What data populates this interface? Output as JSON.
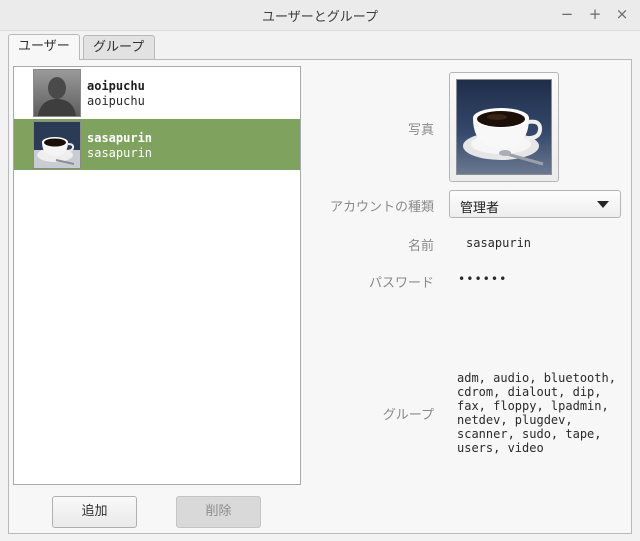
{
  "window": {
    "title": "ユーザーとグループ",
    "minimize_glyph": "−",
    "maximize_glyph": "+",
    "close_glyph": "×"
  },
  "tabs": [
    {
      "label": "ユーザー",
      "active": true
    },
    {
      "label": "グループ",
      "active": false
    }
  ],
  "users": [
    {
      "name": "aoipuchu",
      "login": "aoipuchu",
      "avatar": "default-person-icon",
      "selected": false
    },
    {
      "name": "sasapurin",
      "login": "sasapurin",
      "avatar": "coffee-cup-photo",
      "selected": true
    }
  ],
  "buttons": {
    "add_label": "追加",
    "delete_label": "削除"
  },
  "details": {
    "photo_label": "写真",
    "account_type_label": "アカウントの種類",
    "account_type_value": "管理者",
    "name_label": "名前",
    "name_value": "sasapurin",
    "password_label": "パスワード",
    "password_value": "••••••",
    "groups_label": "グループ",
    "groups_value": "adm, audio, bluetooth, cdrom, dialout, dip, fax, floppy, lpadmin, netdev, plugdev, scanner, sudo, tape, users, video"
  },
  "colors": {
    "selection": "#7fa25e"
  }
}
